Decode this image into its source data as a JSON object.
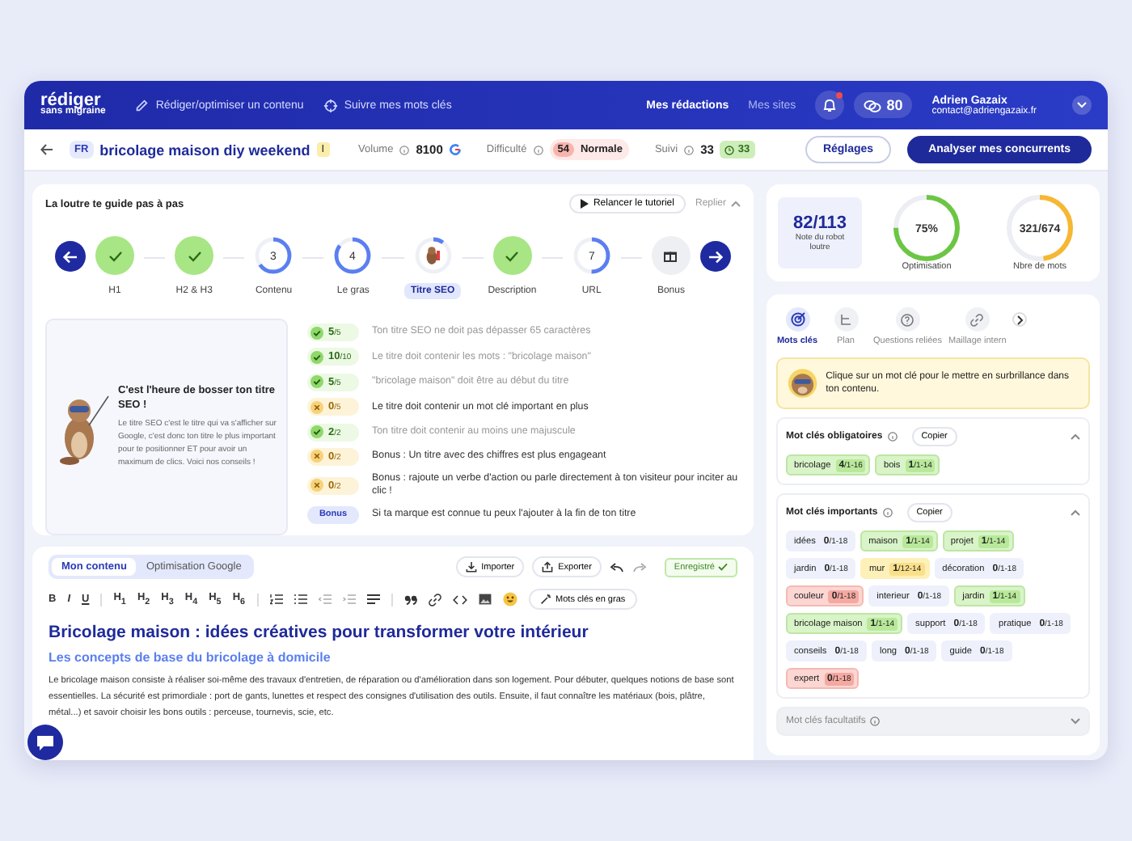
{
  "header": {
    "logo": {
      "top": "rédiger",
      "bottom": "sans migraine"
    },
    "nav": [
      {
        "label": "Rédiger/optimiser un contenu",
        "kind": "pencil"
      },
      {
        "label": "Suivre mes mots clés",
        "kind": "target"
      }
    ],
    "tabs": [
      {
        "label": "Mes rédactions",
        "selected": true
      },
      {
        "label": "Mes sites",
        "selected": false
      }
    ],
    "notification": true,
    "credits": "80",
    "user": {
      "name": "Adrien Gazaix",
      "email": "contact@adriengazaix.fr"
    }
  },
  "keyword_bar": {
    "lang": "FR",
    "keyword": "bricolage maison diy weekend",
    "intent": "I",
    "volume": {
      "label": "Volume",
      "value": "8100"
    },
    "difficulty": {
      "label": "Difficulté",
      "score": "54",
      "level": "Normale"
    },
    "tracking": {
      "label": "Suivi",
      "value": "33",
      "badge": "33"
    },
    "buttons": [
      {
        "label": "Réglages",
        "kind": "outline"
      },
      {
        "label": "Analyser mes concurrents",
        "kind": "primary"
      }
    ]
  },
  "guide": {
    "title": "La loutre te guide pas à pas",
    "relaunch": "Relancer le tutoriel",
    "collapse": "Replier",
    "steps": [
      {
        "label": "H1",
        "kind": "done",
        "selected": false
      },
      {
        "label": "H2 & H3",
        "kind": "done",
        "selected": false
      },
      {
        "label": "Contenu",
        "kind": "progress",
        "number": "3",
        "level": 0.65,
        "selected": false
      },
      {
        "label": "Le gras",
        "kind": "progress",
        "number": "4",
        "level": 0.85,
        "selected": false
      },
      {
        "label": "Titre SEO",
        "kind": "current",
        "level": 0.1,
        "selected": true
      },
      {
        "label": "Description",
        "kind": "done",
        "selected": false
      },
      {
        "label": "URL",
        "kind": "progress",
        "number": "7",
        "level": 0.5,
        "selected": false
      },
      {
        "label": "Bonus",
        "kind": "bonus",
        "selected": false
      }
    ],
    "tip": {
      "title": "C'est l'heure de bosser ton titre SEO !",
      "text": "Le titre SEO c'est le titre qui va s'afficher sur Google, c'est donc ton titre le plus important pour te positionner ET pour avoir un maximum de clics. Voici nos conseils !"
    },
    "criteria": [
      {
        "kind": "ok",
        "score": "5",
        "max": "/5",
        "text": "Ton titre SEO ne doit pas dépasser 65 caractères"
      },
      {
        "kind": "ok",
        "score": "10",
        "max": "/10",
        "text": "Le titre doit contenir les mots : \"bricolage maison\""
      },
      {
        "kind": "ok",
        "score": "5",
        "max": "/5",
        "text": "\"bricolage maison\" doit être au début du titre"
      },
      {
        "kind": "fail",
        "score": "0",
        "max": "/5",
        "text": "Le titre doit contenir un mot clé important en plus"
      },
      {
        "kind": "ok",
        "score": "2",
        "max": "/2",
        "text": "Ton titre doit contenir au moins une majuscule"
      },
      {
        "kind": "fail",
        "score": "0",
        "max": "/2",
        "text": "Bonus : Un titre avec des chiffres est plus engageant"
      },
      {
        "kind": "fail",
        "score": "0",
        "max": "/2",
        "text": "Bonus : rajoute un verbe d'action ou parle directement à ton visiteur pour inciter au clic !"
      },
      {
        "kind": "bonus",
        "badge": "Bonus",
        "text": "Si ta marque est connue tu peux l'ajouter à la fin de ton titre"
      }
    ]
  },
  "editor": {
    "tabs": [
      {
        "label": "Mon contenu",
        "selected": true
      },
      {
        "label": "Optimisation Google",
        "selected": false
      }
    ],
    "actions": [
      {
        "label": "Importer",
        "kind": "import"
      },
      {
        "label": "Exporter",
        "kind": "export"
      }
    ],
    "saved": "Enregistré",
    "format": [
      "B",
      "I",
      "U"
    ],
    "headings": [
      "H$_{1}$",
      "H$_{2}$",
      "H$_{3}$",
      "H$_{4}$",
      "H$_{5}$",
      "H$_{6}$"
    ],
    "bold_keywords": "Mots clés en gras",
    "h1": "Bricolage maison : idées créatives pour transformer votre intérieur",
    "h2": "Les concepts de base du bricolage à domicile",
    "paragraph": "Le bricolage maison consiste à réaliser soi-même des travaux d'entretien, de réparation ou d'amélioration dans son logement. Pour débuter, quelques notions de base sont essentielles. La sécurité est primordiale : port de gants, lunettes et respect des consignes d'utilisation des outils. Ensuite, il faut connaître les matériaux (bois, plâtre, métal...) et savoir choisir les bons outils : perceuse, tournevis, scie, etc."
  },
  "scores": {
    "robot": {
      "value": "82/113",
      "label": "Note du robot loutre"
    },
    "gauges": [
      {
        "value": "75%",
        "label": "Optimisation",
        "level": 0.75,
        "color": "#6cc644"
      },
      {
        "value": "321/674",
        "label": "Nbre de mots",
        "level": 0.48,
        "color": "#f7b733"
      }
    ]
  },
  "side_tabs": [
    {
      "label": "Mots clés",
      "kind": "target",
      "selected": true
    },
    {
      "label": "Plan",
      "kind": "plan",
      "selected": false
    },
    {
      "label": "Questions reliées",
      "kind": "question",
      "selected": false
    },
    {
      "label": "Maillage intern",
      "kind": "link",
      "selected": false
    }
  ],
  "hint": "Clique sur un mot clé pour le mettre en surbrillance dans ton contenu.",
  "keyword_groups": [
    {
      "title": "Mot clés obligatoires",
      "copy": "Copier",
      "expanded": true,
      "keywords": [
        {
          "word": "bricolage",
          "count": "4",
          "range": "/1-16",
          "kind": "ok"
        },
        {
          "word": "bois",
          "count": "1",
          "range": "/1-14",
          "kind": "ok"
        }
      ]
    },
    {
      "title": "Mot clés importants",
      "copy": "Copier",
      "expanded": true,
      "keywords": [
        {
          "word": "idées",
          "count": "0",
          "range": "/1-18",
          "kind": "none"
        },
        {
          "word": "maison",
          "count": "1",
          "range": "/1-14",
          "kind": "ok"
        },
        {
          "word": "projet",
          "count": "1",
          "range": "/1-14",
          "kind": "ok"
        },
        {
          "word": "jardin",
          "count": "0",
          "range": "/1-18",
          "kind": "none"
        },
        {
          "word": "mur",
          "count": "1",
          "range": "/12-14",
          "kind": "warn"
        },
        {
          "word": "décoration",
          "count": "0",
          "range": "/1-18",
          "kind": "none"
        },
        {
          "word": "couleur",
          "count": "0",
          "range": "/1-18",
          "kind": "bad"
        },
        {
          "word": "interieur",
          "count": "0",
          "range": "/1-18",
          "kind": "none"
        },
        {
          "word": "jardin",
          "count": "1",
          "range": "/1-14",
          "kind": "ok"
        },
        {
          "word": "bricolage maison",
          "count": "1",
          "range": "/1-14",
          "kind": "ok"
        },
        {
          "word": "support",
          "count": "0",
          "range": "/1-18",
          "kind": "none"
        },
        {
          "word": "pratique",
          "count": "0",
          "range": "/1-18",
          "kind": "none"
        },
        {
          "word": "conseils",
          "count": "0",
          "range": "/1-18",
          "kind": "none"
        },
        {
          "word": "long",
          "count": "0",
          "range": "/1-18",
          "kind": "none"
        },
        {
          "word": "guide",
          "count": "0",
          "range": "/1-18",
          "kind": "none"
        },
        {
          "word": "expert",
          "count": "0",
          "range": "/1-18",
          "kind": "bad"
        }
      ]
    },
    {
      "title": "Mot clés facultatifs",
      "expanded": false
    }
  ]
}
